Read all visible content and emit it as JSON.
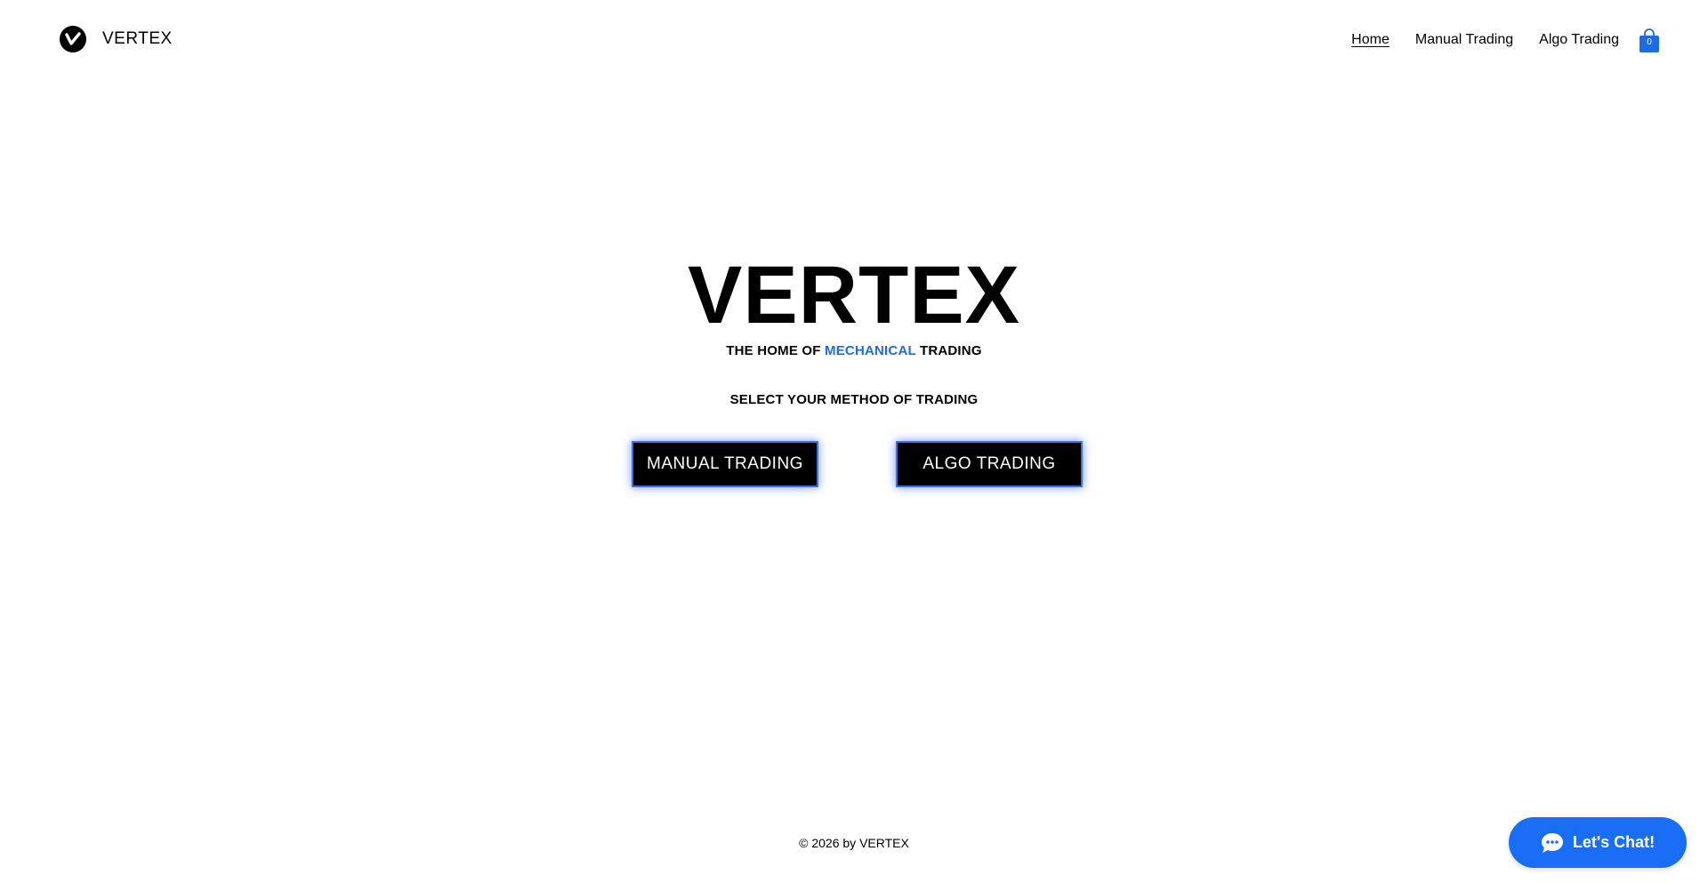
{
  "header": {
    "brand_name": "VERTEX",
    "logo_icon": "vertex-v-logo-icon",
    "nav": [
      {
        "label": "Home",
        "active": true
      },
      {
        "label": "Manual Trading",
        "active": false
      },
      {
        "label": "Algo Trading",
        "active": false
      }
    ],
    "cart": {
      "icon": "shopping-bag-icon",
      "count": "0",
      "color": "#1f6ce0"
    }
  },
  "hero": {
    "title": "VERTEX",
    "tagline_before": "THE HOME OF",
    "tagline_accent": "MECHANICAL",
    "tagline_after": "TRADING",
    "accent_color": "#1f6ce0",
    "select_label": "SELECT YOUR METHOD OF TRADING",
    "buttons": {
      "manual": "MANUAL TRADING",
      "algo": "ALGO TRADING"
    },
    "button_glow_color": "#3b6fe8"
  },
  "footer": {
    "copyright": "© 2026 by VERTEX"
  },
  "chat": {
    "label": "Let's Chat!",
    "icon": "chat-bubble-icon",
    "color": "#1a6ef5"
  }
}
